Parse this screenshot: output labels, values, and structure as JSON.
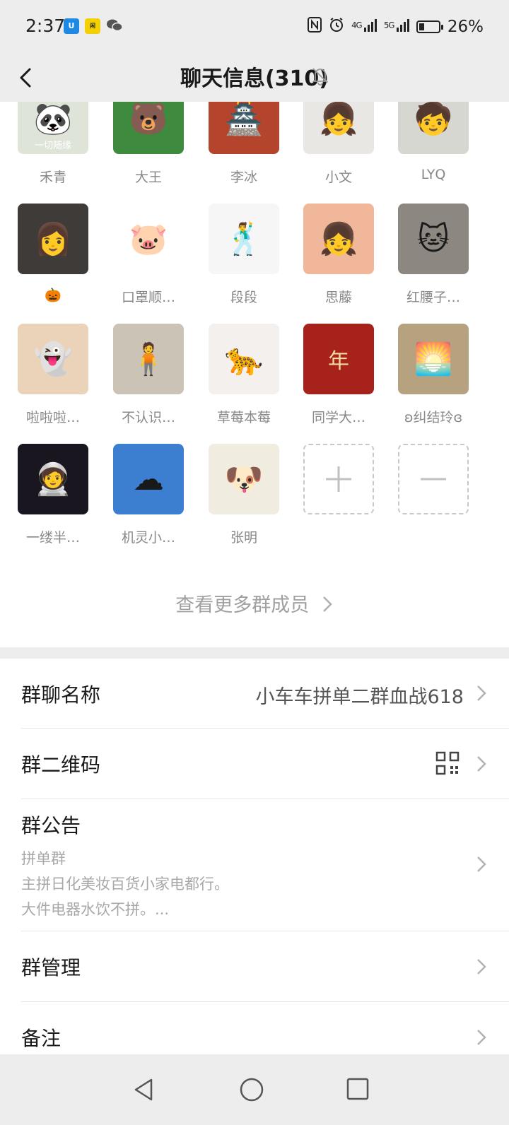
{
  "status_bar": {
    "time": "2:37",
    "battery": "26%",
    "battery_level": 0.26,
    "network_1": "4G",
    "network_2": "5G",
    "app_icons": [
      "shield-app-icon",
      "xianyu-app-icon",
      "wechat-icon"
    ]
  },
  "nav": {
    "title": "聊天信息(310)"
  },
  "members": [
    {
      "name": "禾青",
      "avatar": "panda-avatar",
      "bg": "#dfe4d8",
      "glyph": "🐼"
    },
    {
      "name": "大王",
      "avatar": "kumamon-avatar",
      "bg": "#3e8a3e",
      "glyph": "🐻"
    },
    {
      "name": "李冰",
      "avatar": "palace-avatar",
      "bg": "#b5442c",
      "glyph": "🏯"
    },
    {
      "name": "小文",
      "avatar": "girl-photo-avatar",
      "bg": "#e9e7e4",
      "glyph": "👧"
    },
    {
      "name": "LYQ",
      "avatar": "child-photo-avatar",
      "bg": "#d7d7d2",
      "glyph": "🧒"
    },
    {
      "name": "🎃",
      "avatar": "woman-portrait-avatar",
      "bg": "#3f3b38",
      "glyph": "👩"
    },
    {
      "name": "口罩顺…",
      "avatar": "pink-bear-avatar",
      "bg": "#ffffff",
      "glyph": "🐷"
    },
    {
      "name": "段段",
      "avatar": "doodle-avatar",
      "bg": "#f6f6f6",
      "glyph": "🕺"
    },
    {
      "name": "思藤",
      "avatar": "anime-girl-avatar",
      "bg": "#f0b79a",
      "glyph": "👧"
    },
    {
      "name": "红腰子…",
      "avatar": "cat-avatar",
      "bg": "#8c8781",
      "glyph": "🐱"
    },
    {
      "name": "啦啦啦…",
      "avatar": "ghost-avatar",
      "bg": "#ead3b8",
      "glyph": "👻"
    },
    {
      "name": "不认识…",
      "avatar": "woman-room-avatar",
      "bg": "#cbc3b6",
      "glyph": "🧍"
    },
    {
      "name": "草莓本莓",
      "avatar": "pink-panther-avatar",
      "bg": "#f3f0ee",
      "glyph": "🐆"
    },
    {
      "name": "同学大…",
      "avatar": "red-calligraphy-avatar",
      "bg": "#a8221c",
      "glyph": "年"
    },
    {
      "name": "ʚ纠结玲ɞ",
      "avatar": "sunset-avatar",
      "bg": "#b6a27e",
      "glyph": "🌅"
    },
    {
      "name": "一缕半…",
      "avatar": "astronaut-avatar",
      "bg": "#1a1620",
      "glyph": "🧑‍🚀"
    },
    {
      "name": "机灵小…",
      "avatar": "heart-cloud-avatar",
      "bg": "#3c7fd0",
      "glyph": "☁"
    },
    {
      "name": "张明",
      "avatar": "cartoon-avatar",
      "bg": "#f1ece0",
      "glyph": "🐶"
    }
  ],
  "panda_caption": "一切随缘",
  "view_more": "查看更多群成员",
  "settings": {
    "group_name_label": "群聊名称",
    "group_name_value": "小车车拼单二群血战618",
    "qr_label": "群二维码",
    "notice_label": "群公告",
    "notice_lines": [
      "拼单群",
      "主拼日化美妆百货小家电都行。",
      "大件电器水饮不拼。..."
    ],
    "manage_label": "群管理",
    "remark_label": "备注"
  },
  "colors": {
    "background": "#ededed",
    "text_primary": "#191919",
    "text_secondary": "#888888"
  }
}
